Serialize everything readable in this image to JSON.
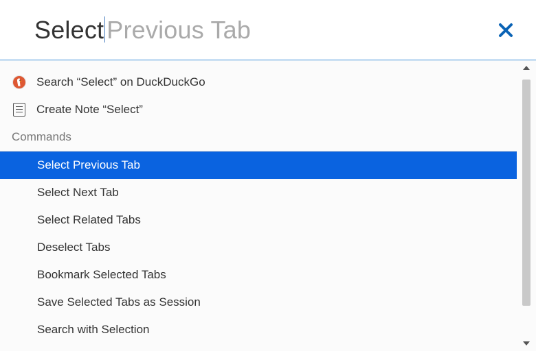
{
  "search": {
    "typed": "Select",
    "suggestion": " Previous Tab"
  },
  "actions": {
    "search_label": "Search “Select” on DuckDuckGo",
    "note_label": "Create Note “Select”"
  },
  "section": {
    "commands_header": "Commands"
  },
  "commands": {
    "items": [
      "Select Previous Tab",
      "Select Next Tab",
      "Select Related Tabs",
      "Deselect Tabs",
      "Bookmark Selected Tabs",
      "Save Selected Tabs as Session",
      "Search with Selection"
    ],
    "selected_index": 0
  },
  "colors": {
    "selection": "#0a63e0",
    "accent": "#0a63b5"
  }
}
